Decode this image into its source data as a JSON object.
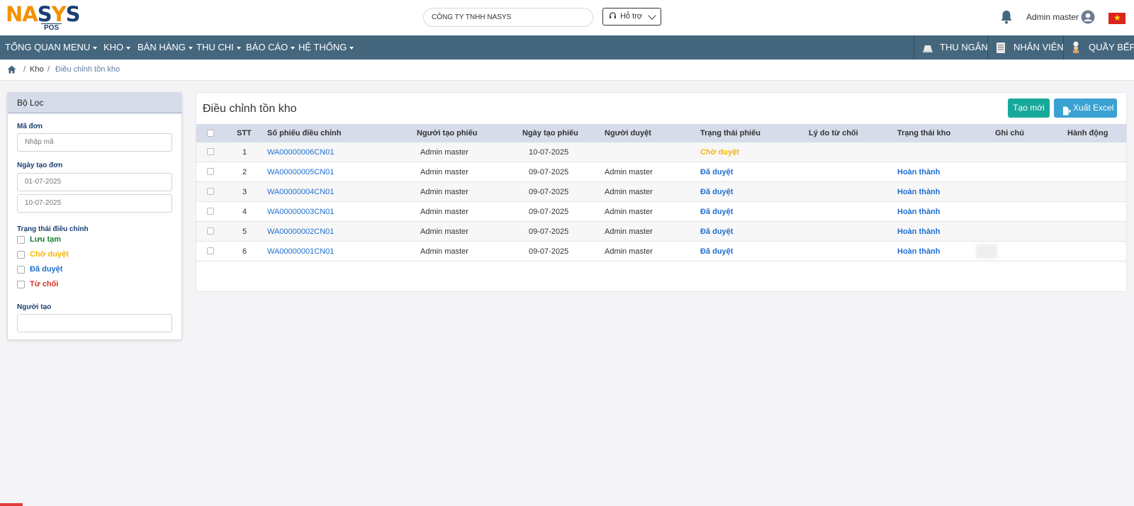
{
  "header": {
    "logo_text": "NASYS",
    "logo_sub": "POS",
    "company": "CÔNG TY TNHH NASYS",
    "support_label": "Hỗ trợ",
    "username": "Admin master"
  },
  "nav": {
    "left": [
      "TỔNG QUAN",
      "MENU",
      "KHO",
      "BÁN HÀNG",
      "THU CHI",
      "BÁO CÁO",
      "HỆ THỐNG"
    ],
    "right": [
      "THU NGÂN",
      "NHÂN VIÊN",
      "QUẦY BẾP"
    ]
  },
  "breadcrumb": {
    "items": [
      "Kho",
      "Điều chỉnh tồn kho"
    ]
  },
  "filter": {
    "title": "Bộ Lọc",
    "code_label": "Mã đơn",
    "code_placeholder": "Nhập mã",
    "date_label": "Ngày tạo đơn",
    "date_from": "01-07-2025",
    "date_to": "10-07-2025",
    "status_label": "Trạng thái điều chỉnh",
    "statuses": [
      {
        "label": "Lưu tạm",
        "color": "#1a7f37"
      },
      {
        "label": "Chờ duyệt",
        "color": "#f7b500"
      },
      {
        "label": "Đã duyệt",
        "color": "#1e6fd0"
      },
      {
        "label": "Từ chối",
        "color": "#d93025"
      }
    ],
    "creator_label": "Người tạo",
    "creator_value": ""
  },
  "main": {
    "title": "Điều chỉnh tồn kho",
    "new_button": "Tạo mới",
    "excel_button": "Xuất Excel",
    "columns": [
      "STT",
      "Số phiếu điều chỉnh",
      "Người tạo phiếu",
      "Ngày tạo phiếu",
      "Người duyệt",
      "Trạng thái phiếu",
      "Lý do từ chối",
      "Trạng thái kho",
      "Ghi chú",
      "Hành động"
    ],
    "rows": [
      {
        "stt": "1",
        "code": "WA00000006CN01",
        "creator": "Admin master",
        "date": "10-07-2025",
        "approver": "",
        "status": "Chờ duyệt",
        "reason": "",
        "stock": "",
        "note": ""
      },
      {
        "stt": "2",
        "code": "WA00000005CN01",
        "creator": "Admin master",
        "date": "09-07-2025",
        "approver": "Admin master",
        "status": "Đã duyệt",
        "reason": "",
        "stock": "Hoàn thành",
        "note": ""
      },
      {
        "stt": "3",
        "code": "WA00000004CN01",
        "creator": "Admin master",
        "date": "09-07-2025",
        "approver": "Admin master",
        "status": "Đã duyệt",
        "reason": "",
        "stock": "Hoàn thành",
        "note": ""
      },
      {
        "stt": "4",
        "code": "WA00000003CN01",
        "creator": "Admin master",
        "date": "09-07-2025",
        "approver": "Admin master",
        "status": "Đã duyệt",
        "reason": "",
        "stock": "Hoàn thành",
        "note": ""
      },
      {
        "stt": "5",
        "code": "WA00000002CN01",
        "creator": "Admin master",
        "date": "09-07-2025",
        "approver": "Admin master",
        "status": "Đã duyệt",
        "reason": "",
        "stock": "Hoàn thành",
        "note": ""
      },
      {
        "stt": "6",
        "code": "WA00000001CN01",
        "creator": "Admin master",
        "date": "09-07-2025",
        "approver": "Admin master",
        "status": "Đã duyệt",
        "reason": "",
        "stock": "Hoàn thành",
        "note": ""
      }
    ]
  },
  "icons": {
    "bell": "bell-icon",
    "avatar": "user-circle-icon",
    "flag": "vietnam-flag-icon",
    "home": "home-icon",
    "support": "headset-icon",
    "excel": "file-export-icon"
  },
  "colors": {
    "nav_bg": "#44677e",
    "header_row": "#d6dcea",
    "btn_new": "#16a99a",
    "btn_excel": "#3aa2d3",
    "link": "#1e6fd0",
    "pending": "#f7b500"
  }
}
